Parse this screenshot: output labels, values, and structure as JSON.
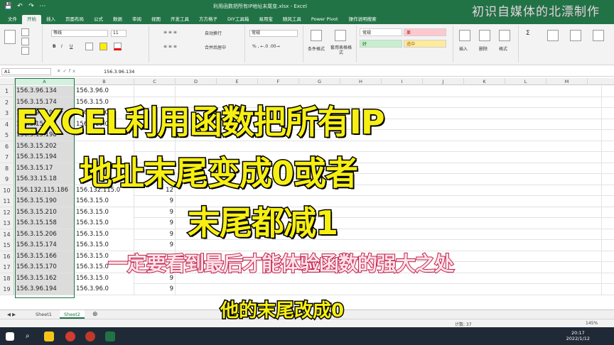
{
  "titlebar": {
    "title": "利用函数把所有IP地址末尾变.xlsx - Excel",
    "quick_access": [
      "💾",
      "↶",
      "↷",
      "⋯"
    ]
  },
  "ribbon_tabs": [
    "文件",
    "开始",
    "插入",
    "页面布局",
    "公式",
    "数据",
    "审阅",
    "视图",
    "开发工具",
    "方方格子",
    "DIY工具箱",
    "易用宝",
    "随风工具",
    "Power Pivot"
  ],
  "ribbon_search": "操作说明搜索",
  "ribbon": {
    "font_name": "等线",
    "font_size": "11",
    "wrap_text": "自动换行",
    "merge": "合并后居中",
    "number_format": "常规",
    "style_normal": "常规",
    "style_bad": "差",
    "style_good": "好",
    "style_neutral": "适中",
    "cond_format": "条件格式",
    "table_format": "套用表格格式",
    "insert": "插入",
    "delete": "删除",
    "format": "格式"
  },
  "formula_bar": {
    "name_box": "A1",
    "value": "156.3.96.134"
  },
  "columns": [
    "A",
    "B",
    "C",
    "D",
    "E",
    "F",
    "G",
    "H",
    "I",
    "J",
    "K",
    "L",
    "M"
  ],
  "rows": [
    {
      "n": "1",
      "a": "156.3.96.134",
      "b": "156.3.96.0",
      "c": "",
      "d": ""
    },
    {
      "n": "2",
      "a": "156.3.15.174",
      "b": "156.3.15.0",
      "c": "",
      "d": ""
    },
    {
      "n": "3",
      "a": "156.3.96.198",
      "b": "156.3.96.0",
      "c": "",
      "d": ""
    },
    {
      "n": "4",
      "a": "156.3.15.170",
      "b": "156.3.15.0",
      "c": "",
      "d": ""
    },
    {
      "n": "5",
      "a": "156.3.15.198",
      "b": "",
      "c": "",
      "d": ""
    },
    {
      "n": "6",
      "a": "156.3.15.202",
      "b": "",
      "c": "",
      "d": ""
    },
    {
      "n": "7",
      "a": "156.3.15.194",
      "b": "",
      "c": "",
      "d": ""
    },
    {
      "n": "8",
      "a": "156.3.15.17",
      "b": "",
      "c": "",
      "d": ""
    },
    {
      "n": "9",
      "a": "156.33.15.18",
      "b": "",
      "c": "",
      "d": ""
    },
    {
      "n": "10",
      "a": "156.132.115.186",
      "b": "156.132.115.0",
      "c": "12",
      "d": ""
    },
    {
      "n": "11",
      "a": "156.3.15.190",
      "b": "156.3.15.0",
      "c": "9",
      "d": ""
    },
    {
      "n": "12",
      "a": "156.3.15.210",
      "b": "156.3.15.0",
      "c": "9",
      "d": ""
    },
    {
      "n": "13",
      "a": "156.3.15.158",
      "b": "156.3.15.0",
      "c": "9",
      "d": ""
    },
    {
      "n": "14",
      "a": "156.3.15.206",
      "b": "156.3.15.0",
      "c": "9",
      "d": ""
    },
    {
      "n": "15",
      "a": "156.3.15.174",
      "b": "156.3.15.0",
      "c": "9",
      "d": ""
    },
    {
      "n": "16",
      "a": "156.3.15.166",
      "b": "156.3.15.0",
      "c": "",
      "d": ""
    },
    {
      "n": "17",
      "a": "156.3.15.170",
      "b": "156.3.15.0",
      "c": "9",
      "d": ""
    },
    {
      "n": "18",
      "a": "156.3.15.162",
      "b": "156.3.15.0",
      "c": "9",
      "d": ""
    },
    {
      "n": "19",
      "a": "156.3.96.194",
      "b": "156.3.96.0",
      "c": "9",
      "d": ""
    }
  ],
  "sheets": [
    "Sheet1",
    "Sheet2"
  ],
  "status": {
    "count": "计数: 37",
    "zoom": "145%"
  },
  "clock": {
    "time": "20:17",
    "date": "2022/1/12"
  },
  "overlay": {
    "line1": "EXCEL利用函数把所有IP",
    "line2": "地址末尾变成0或者",
    "line3": "末尾都减1",
    "subtitle": "一定要看到最后才能体验函数的强大之处",
    "caption": "他的末尾改成0",
    "watermark": "初识自媒体的北漂制作"
  }
}
